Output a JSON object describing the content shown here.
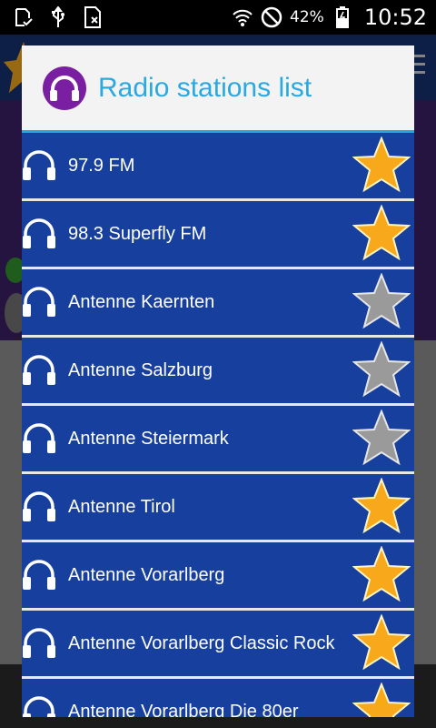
{
  "status_bar": {
    "battery": "42%",
    "time": "10:52",
    "icons": [
      "download-done-icon",
      "usb-icon",
      "sim-card-icon",
      "wifi-icon",
      "do-not-disturb-icon",
      "battery-charging-icon"
    ]
  },
  "dialog": {
    "title": "Radio stations list",
    "logo_icon": "headphones-logo-icon"
  },
  "stations": [
    {
      "name": "97.9 FM",
      "favorite": true
    },
    {
      "name": "98.3 Superfly FM",
      "favorite": true
    },
    {
      "name": "Antenne Kaernten",
      "favorite": false
    },
    {
      "name": "Antenne Salzburg",
      "favorite": false
    },
    {
      "name": "Antenne Steiermark",
      "favorite": false
    },
    {
      "name": "Antenne Tirol",
      "favorite": true
    },
    {
      "name": "Antenne Vorarlberg",
      "favorite": true
    },
    {
      "name": "Antenne Vorarlberg Classic Rock",
      "favorite": true
    },
    {
      "name": "Antenne Vorarlberg Die 80er",
      "favorite": true
    }
  ],
  "colors": {
    "row_background": "#173f9e",
    "title": "#2aa9e0",
    "star_gold": "#f7a81b",
    "star_silver": "#9a9a9a"
  }
}
